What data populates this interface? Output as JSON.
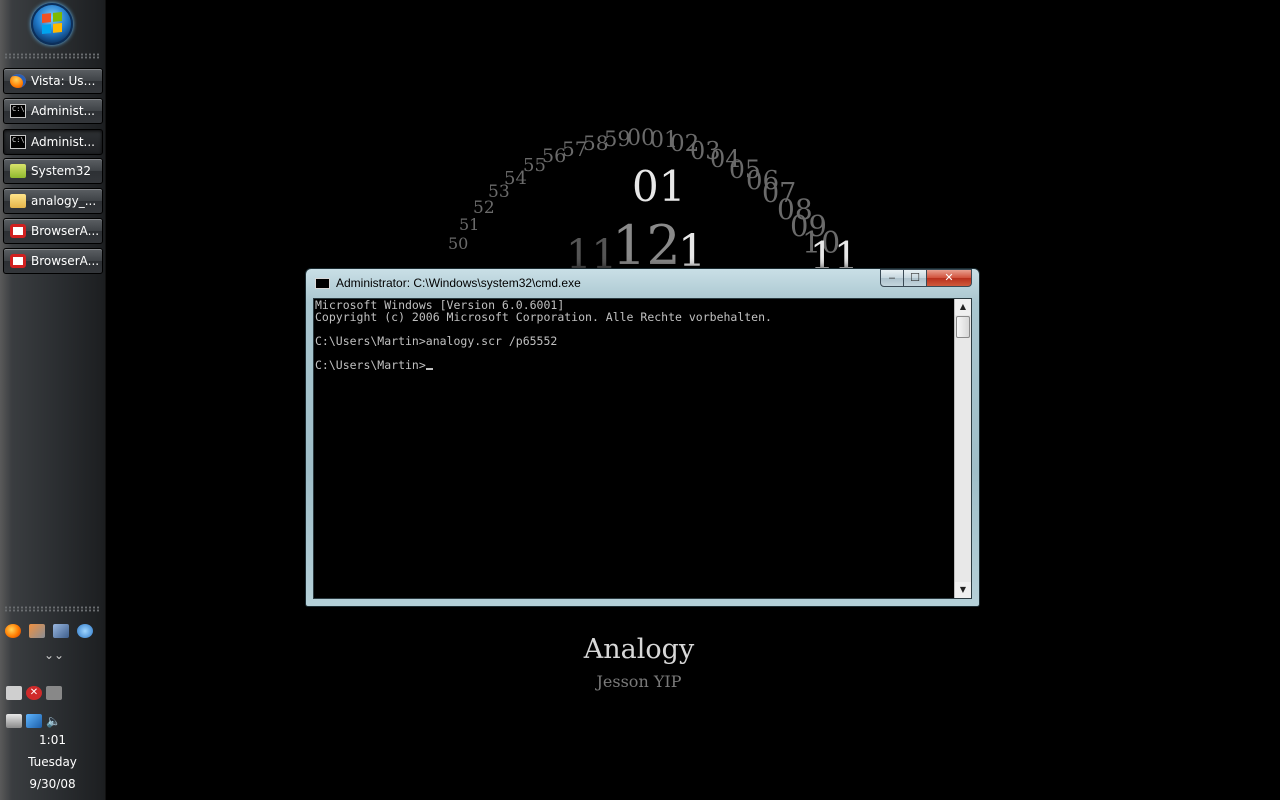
{
  "taskbar": {
    "start_orb_icon": "windows-start-orb-icon",
    "buttons": [
      {
        "label": "Vista: Use...",
        "icon": "firefox-icon",
        "active": false
      },
      {
        "label": "Administ...",
        "icon": "cmd-icon",
        "active": false
      },
      {
        "label": "Administ...",
        "icon": "cmd-icon",
        "active": true
      },
      {
        "label": "System32",
        "icon": "folder-icon",
        "active": false
      },
      {
        "label": "analogy_...",
        "icon": "folder-icon",
        "active": false
      },
      {
        "label": "BrowserA...",
        "icon": "browser-icon",
        "active": false
      },
      {
        "label": "BrowserA...",
        "icon": "browser-icon",
        "active": false
      }
    ],
    "quick_launch_icons": [
      "firefox-icon",
      "network-icon",
      "tool-icon",
      "internet-icon"
    ],
    "expand_chevron": "»",
    "tray_icons_row1": [
      "camera-icon",
      "security-shield-icon",
      "monitor-icon"
    ],
    "tray_icons_row2": [
      "battery-icon",
      "network-status-icon",
      "volume-icon"
    ],
    "clock": {
      "time": "1:01",
      "day": "Tuesday",
      "date": "9/30/08"
    }
  },
  "cmd_window": {
    "title": "Administrator: C:\\Windows\\system32\\cmd.exe",
    "buttons": {
      "minimize": "‒",
      "maximize": "☐",
      "close": "✕"
    },
    "console_lines": [
      "Microsoft Windows [Version 6.0.6001]",
      "Copyright (c) 2006 Microsoft Corporation. Alle Rechte vorbehalten.",
      "",
      "C:\\Users\\Martin>analogy.scr /p65552",
      "",
      "C:\\Users\\Martin>"
    ],
    "scroll_up": "▲",
    "scroll_down": "▼"
  },
  "screensaver": {
    "title": "Analogy",
    "author": "Jesson YIP",
    "dial_numbers": [
      "50",
      "51",
      "52",
      "53",
      "54",
      "55",
      "56",
      "57",
      "58",
      "59",
      "00",
      "01",
      "02",
      "03",
      "04",
      "05",
      "06",
      "07",
      "08",
      "09",
      "10"
    ],
    "big_numbers": {
      "minutes": "01",
      "hours": "12",
      "one": "1",
      "eleven": "11"
    },
    "colors": {
      "background": "#000000",
      "dim_numbers": "#6a6a6a",
      "bright_numbers": "#e8e8e8"
    }
  }
}
